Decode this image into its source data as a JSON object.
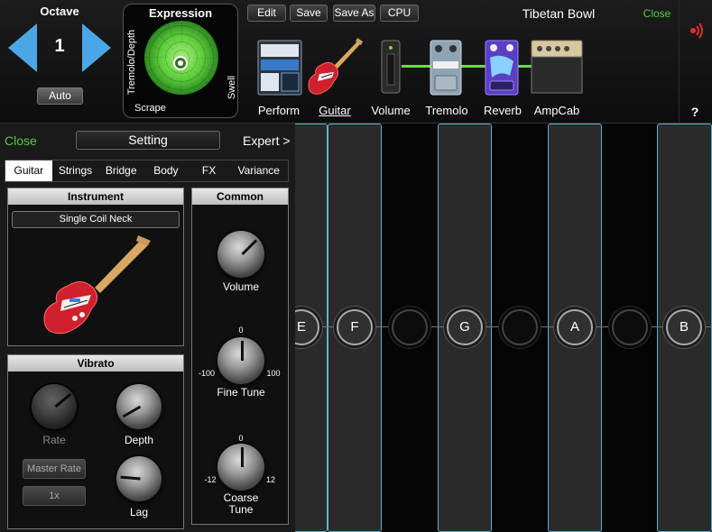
{
  "octave": {
    "title": "Octave",
    "value": "1",
    "auto_label": "Auto"
  },
  "expression": {
    "title": "Expression",
    "left_label": "Tremolo/Depth",
    "right_label": "Swell",
    "bottom_label": "Scrape"
  },
  "toolbar": {
    "edit": "Edit",
    "save": "Save",
    "save_as": "Save As",
    "cpu": "CPU"
  },
  "preset": {
    "name": "Tibetan Bowl",
    "close": "Close",
    "help": "?"
  },
  "chain": [
    "Perform",
    "Guitar",
    "Volume",
    "Tremolo",
    "Reverb",
    "AmpCab"
  ],
  "panel": {
    "close": "Close",
    "setting": "Setting",
    "expert": "Expert >",
    "tabs": [
      "Guitar",
      "Strings",
      "Bridge",
      "Body",
      "FX",
      "Variance"
    ],
    "active_tab": "Guitar"
  },
  "instrument": {
    "title": "Instrument",
    "selection": "Single Coil Neck"
  },
  "vibrato": {
    "title": "Vibrato",
    "rate_label": "Rate",
    "depth_label": "Depth",
    "lag_label": "Lag",
    "master_rate_label": "Master Rate",
    "multiplier": "1x"
  },
  "common": {
    "title": "Common",
    "volume_label": "Volume",
    "fine_tune_label": "Fine Tune",
    "fine_tune_min": "-100",
    "fine_tune_max": "100",
    "fine_tune_center": "0",
    "coarse_tune_label": "Coarse Tune",
    "coarse_tune_min": "-12",
    "coarse_tune_max": "12",
    "coarse_tune_center": "0"
  },
  "notes": [
    "E",
    "F",
    "",
    "G",
    "",
    "A",
    "",
    "B"
  ],
  "colors": {
    "accent_green": "#55cc44",
    "string_blue": "#58b3cf",
    "arrow_blue": "#4aa7e6"
  }
}
